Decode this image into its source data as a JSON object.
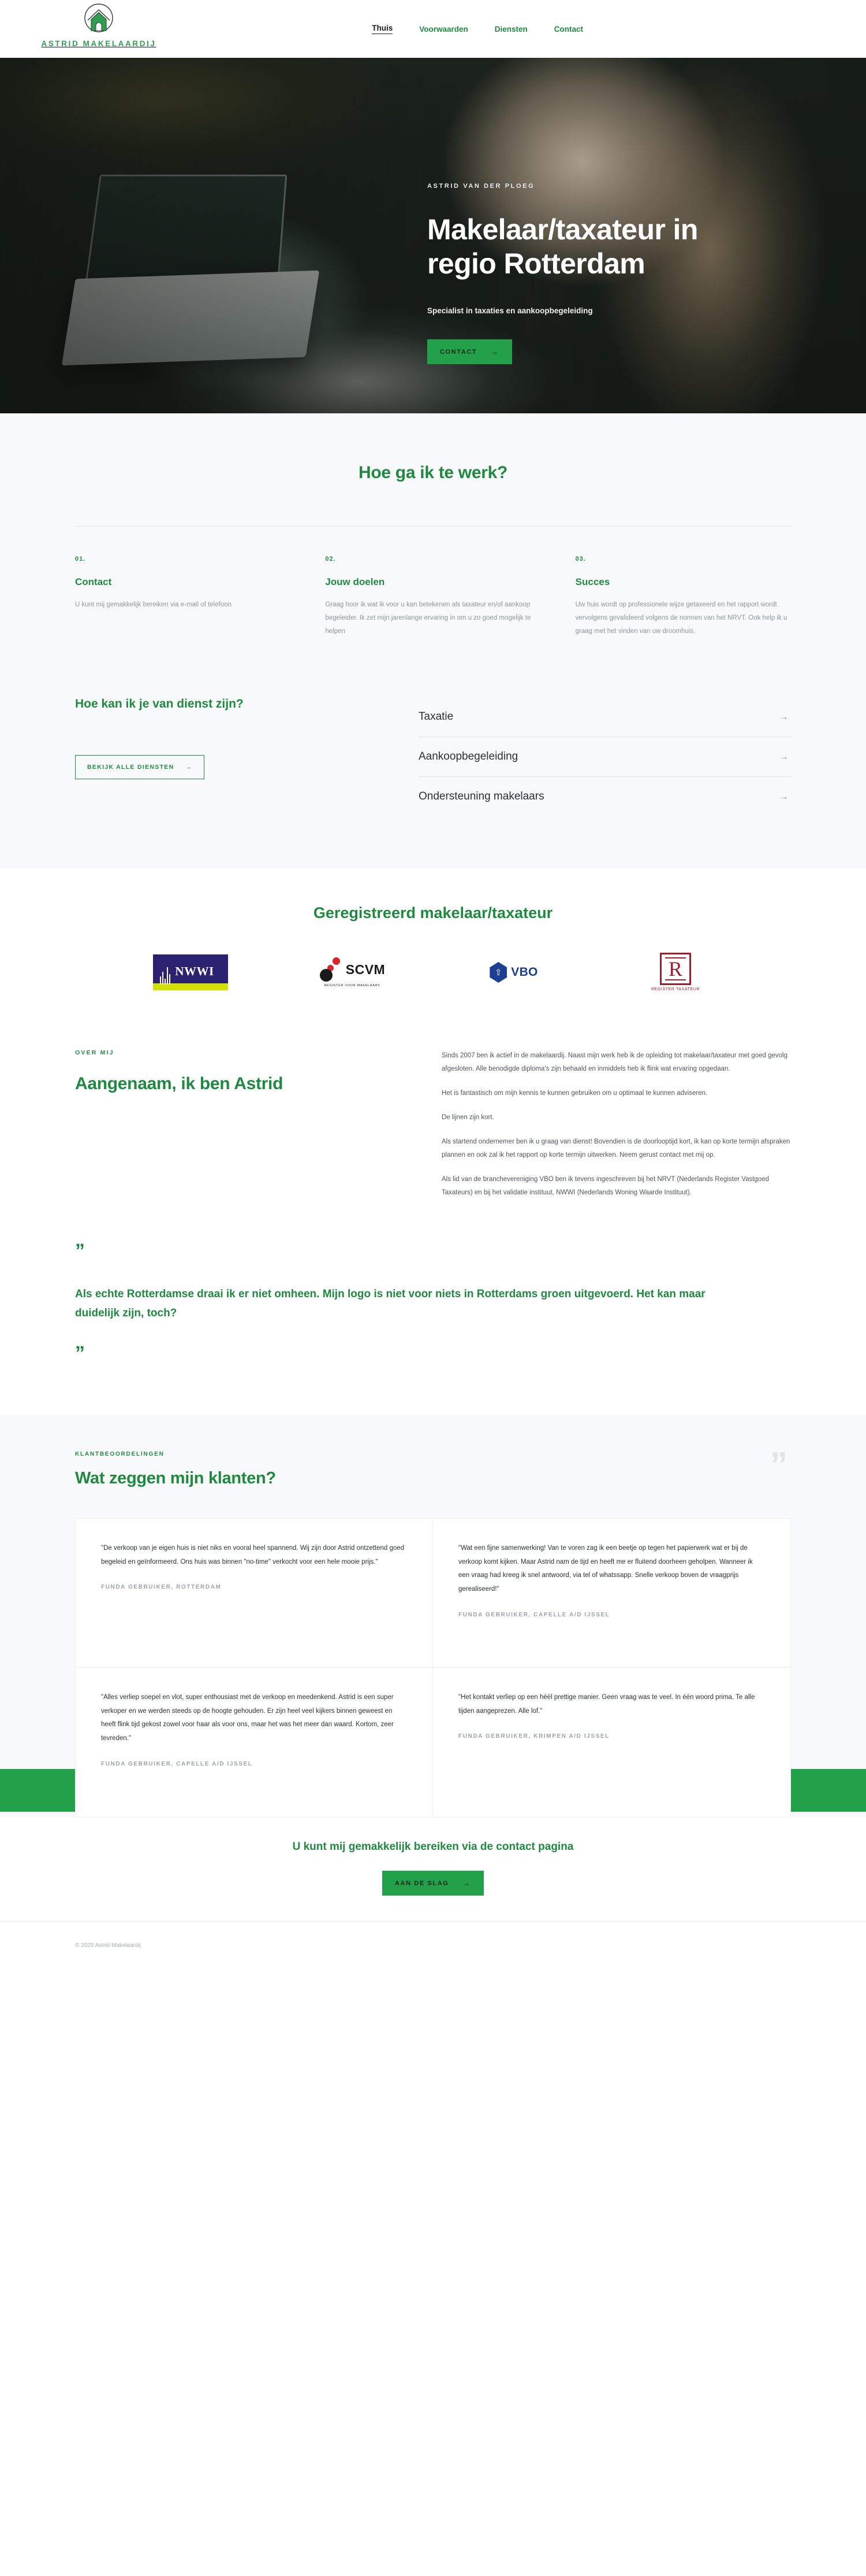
{
  "brand": {
    "name": "ASTRID MAKELAARDIJ",
    "logo_icon": "house-in-circle-logo",
    "accent_green": "#1f8a3f",
    "button_green": "#22a04a"
  },
  "nav": {
    "items": [
      {
        "label": "Thuis",
        "active": true
      },
      {
        "label": "Voorwaarden",
        "active": false
      },
      {
        "label": "Diensten",
        "active": false
      },
      {
        "label": "Contact",
        "active": false
      }
    ]
  },
  "hero": {
    "eyebrow": "ASTRID VAN DER PLOEG",
    "title": "Makelaar/taxateur in regio Rotterdam",
    "subtitle": "Specialist in taxaties en aankoopbegeleiding",
    "cta_label": "CONTACT",
    "cta_arrow": "→"
  },
  "process": {
    "title": "Hoe ga ik te werk?",
    "steps": [
      {
        "num": "01.",
        "title": "Contact",
        "body": "U kunt mij gemakkelijk bereiken via e-mail of telefoon"
      },
      {
        "num": "02.",
        "title": "Jouw doelen",
        "body": "Graag hoor ik wat ik voor u kan betekenen als taxateur en/of aankoop begeleider. Ik zet mijn jarenlange ervaring in om u zo goed mogelijk te helpen"
      },
      {
        "num": "03.",
        "title": "Succes",
        "body": "Uw huis wordt op professionele wijze getaxeerd en het rapport wordt vervolgens gevalideerd volgens de normen van het NRVT. Ook help ik u graag met het vinden van uw droomhuis."
      }
    ]
  },
  "services": {
    "heading": "Hoe kan ik je van dienst zijn?",
    "button_label": "BEKIJK ALLE DIENSTEN",
    "button_arrow": "→",
    "items": [
      {
        "name": "Taxatie",
        "arrow": "→"
      },
      {
        "name": "Aankoopbegeleiding",
        "arrow": "→"
      },
      {
        "name": "Ondersteuning makelaars",
        "arrow": "→"
      }
    ]
  },
  "registry": {
    "title": "Geregistreerd makelaar/taxateur",
    "logos": [
      {
        "name": "NWWI",
        "sub": "Nederlands Woning Waarde Instituut",
        "icon": "nwwi-logo"
      },
      {
        "name": "SCVM",
        "sub": "REGISTER VOOR MAKELAARS",
        "icon": "scvm-logo"
      },
      {
        "name": "VBO",
        "sub": "",
        "icon": "vbo-logo"
      },
      {
        "name": "R",
        "sub": "REGISTER TAXATEUR",
        "icon": "register-taxateur-logo"
      }
    ]
  },
  "about": {
    "eyebrow": "OVER MIJ",
    "title": "Aangenaam, ik ben Astrid",
    "paragraphs": [
      "Sinds 2007 ben ik actief in de makelaardij. Naast mijn werk heb ik de opleiding tot makelaar/taxateur met goed gevolg afgesloten. Alle benodigde diploma's zijn behaald en inmiddels heb ik flink wat ervaring opgedaan.",
      "Het is fantastisch om mijn kennis te kunnen gebruiken om u optimaal te kunnen adviseren.",
      "De lijnen zijn kort.",
      "Als startend ondernemer ben ik u graag van dienst! Bovendien is de doorlooptijd kort, ik kan op korte termijn afspraken plannen en ook zal ik het rapport op korte termijn uitwerken. Neem gerust contact met mij op.",
      "Als lid van de branchevereniging VBO ben ik tevens ingeschreven bij het NRVT (Nederlands Register Vastgoed Taxateurs) en bij het validatie instituut, NWWI (Nederlands Woning Waarde Instituut)."
    ]
  },
  "quote": {
    "open_mark": "”",
    "close_mark": "”",
    "text": "Als echte Rotterdamse draai ik er niet omheen. Mijn logo is niet voor niets in Rotterdams groen uitgevoerd. Het kan maar duidelijk zijn, toch?"
  },
  "testimonials": {
    "eyebrow": "KLANTBEOORDELINGEN",
    "title": "Wat zeggen mijn klanten?",
    "decor_quote": "”",
    "cards": [
      {
        "quote": "\"De verkoop van je eigen huis is niet niks en vooral heel spannend. Wij zijn door Astrid ontzettend goed begeleid en geïnformeerd. Ons huis was binnen \"no-time\" verkocht voor een hele mooie prijs.\"",
        "author": "FUNDA GEBRUIKER, ROTTERDAM"
      },
      {
        "quote": "\"Wat een fijne samenwerking! Van te voren zag ik een beetje op tegen het papierwerk wat er bij de verkoop komt kijken. Maar Astrid nam de tijd en heeft me er fluitend doorheen geholpen. Wanneer ik een vraag had kreeg ik snel antwoord, via tel of whatssapp. Snelle verkoop boven de vraagprijs gerealiseerd!\"",
        "author": "FUNDA GEBRUIKER, CAPELLE A/D IJSSEL"
      },
      {
        "quote": "\"Alles verliep soepel en vlot, super enthousiast met de verkoop en meedenkend. Astrid is een super verkoper en we werden steeds op de hoogte gehouden. Er zijn heel veel kijkers binnen geweest en heeft flink tijd gekost zowel voor haar als voor ons, maar het was het meer dan waard. Kortom, zeer tevreden.\"",
        "author": "FUNDA GEBRUIKER, CAPELLE A/D IJSSEL"
      },
      {
        "quote": "\"Het kontakt verliep op een héél prettige manier. Geen vraag was te veel. In één woord prima. Te alle tijden aangeprezen. Alle lof.\"",
        "author": "FUNDA GEBRUIKER, KRIMPEN A/D IJSSEL"
      }
    ]
  },
  "cta": {
    "title": "U kunt mij gemakkelijk bereiken via de contact pagina",
    "button_label": "AAN DE SLAG",
    "button_arrow": "→"
  },
  "footer": {
    "copyright": "© 2025 Astrid Makelaardij"
  }
}
